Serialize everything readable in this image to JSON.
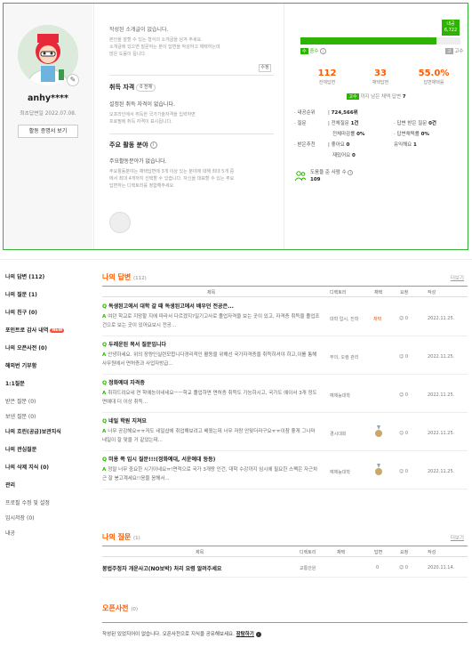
{
  "profile": {
    "username": "anhy****",
    "joined": "최초답변일 2022.07.08.",
    "cert_button": "활동 증명서 보기",
    "intro": {
      "title": "작성된 소개글이 없습니다.",
      "body": "본인을 잘할 수 있는 형식의 소개글을 남겨 주세요.\n소개글에 있으면 질문하는 분이 답변을 작성하고 체택하는데\n많은 도움이 됩니다.",
      "edit_label": "수정"
    },
    "license": {
      "title": "취득 자격",
      "pill": "0 전체",
      "main": "설정된 취득 자격이 없습니다.",
      "desc": "오프라인에서 취득한 국가기술자격을 입력하면\n프로필에 취득 자격이 표시됩니다."
    },
    "activity": {
      "title": "주요 활동 분야",
      "main": "주요활동분야가 없습니다.",
      "desc": "주요활동분야는 채택답변에 3개 이상 있는 분야에 대해 최대 5개 중\n에서 최대 4개까지 선택할 수 있습니다. 자신을 대표할 수 있는 주요\n답변하는 디렉토리를 정함해주세요."
    },
    "level": {
      "badge_top": "내공",
      "badge_value": "6,722",
      "progress_fraction": 0.85,
      "current_rank": "중수",
      "current_rank_icon": "수",
      "next_rank": "고수",
      "next_rank_icon": "고"
    },
    "stats": [
      {
        "value": "112",
        "label": "전체답변"
      },
      {
        "value": "33",
        "label": "채택답변"
      },
      {
        "value": "55.0%",
        "label": "답변채택률"
      }
    ],
    "next_level": {
      "badge": "고수",
      "text_prefix": "까지 남은 채택 답변",
      "count": "7"
    },
    "rank": {
      "label": "내공순위",
      "value": "724,566위"
    },
    "questions": {
      "label": "질문",
      "total_label": "전체질문",
      "total": "1건",
      "choice_rate_label": "전체마감률",
      "choice_rate": "0%",
      "answered_label": "답변 받은 질문",
      "answered": "0건",
      "answer_rate_label": "답변채택률",
      "answer_rate": "0%"
    },
    "recommend": {
      "label": "받은추천",
      "likes_label": "좋아요",
      "likes": "0",
      "expert_label": "유익해요",
      "expert": "1",
      "fun_label": "재밌어요",
      "fun": "0"
    },
    "donate": {
      "label": "도움을 준 사람 수",
      "count": "109"
    }
  },
  "sidebar": {
    "items": [
      {
        "label": "나의 답변 (112)",
        "head": true
      },
      {
        "label": "나의 질문 (1)",
        "head": true
      },
      {
        "label": "나의 친구 (0)",
        "head": true
      },
      {
        "label": "포인트로 감사 내역",
        "head": true,
        "badge": "NEW"
      },
      {
        "label": "나의 오픈사전 (0)",
        "head": true
      },
      {
        "label": "해외번 기부함",
        "head": true
      },
      {
        "label": "1:1질문",
        "head": true
      },
      {
        "label": "받은 질문 (0)",
        "head": false
      },
      {
        "label": "보낸 질문 (0)",
        "head": false
      },
      {
        "label": "나의 흐린(공급)보관지식",
        "head": true
      },
      {
        "label": "나의 관심질문",
        "head": true
      },
      {
        "label": "나의 삭제 지식 (0)",
        "head": true
      },
      {
        "label": "관리",
        "head": true
      },
      {
        "label": "프로필 수정 및 설정",
        "head": false
      },
      {
        "label": "임시저장 (0)",
        "head": false
      },
      {
        "label": "내공",
        "head": false
      }
    ]
  },
  "answers": {
    "title": "나의 답변",
    "count": "(112)",
    "more": "더보기",
    "headers": {
      "title": "제목",
      "directory": "디렉토리",
      "choice": "채택",
      "good": "요청",
      "date": "작성"
    },
    "rows": [
      {
        "q": "독생된고에서 대학 갈 때 독생된고에서 배우던 전공은...",
        "a": "여던 학교로 지망할 지에 따라서 다르겠지?일기고사로 졸업자격을 보는 곳이 있고, 자격증 취득을 졸업조건으로 보는 곳이 있어요보시 전공...",
        "dir": "대학 입시, 진학",
        "choice": "채택",
        "good": "0",
        "date": "2022.11.25.",
        "medal": false
      },
      {
        "q": "두레운된 목서 질문입니다",
        "a": "안녕하세요. 위의 장량인실련모합니다경리적인 활동을 위해선 국가자격증을 취득하셔야 하고,이를 통해 사무원에서 면허증과 사업자방급...",
        "dir": "무의, 오컴 관리",
        "choice": "",
        "good": "0",
        "date": "2022.11.25.",
        "medal": false
      },
      {
        "q": "정화예대 자격증",
        "a": "취하드려요네 연 학예능이네네요ㅡㅡ학교 졸업하면 면허증 취득도 가능하시고, 국가도 예이서 3개 정도면예대 더 이상 취득...",
        "dir": "예체능대학",
        "choice": "",
        "good": "0",
        "date": "2022.11.25.",
        "medal": false
      },
      {
        "q": "네일 학원 지쳐요",
        "a": "너무 공감해요ㅠㅠ저도 네일샵에 취업해보려고 배웠는데 너무 저랑 안맞더라구요ㅠㅠ이참 좋게 그나마 네일이 잘 맞을 거 같았는데...",
        "dir": "경시대회",
        "choice": "",
        "good": "0",
        "date": "2022.11.25.",
        "medal": true
      },
      {
        "q": "미용 쪽 입시 질문!!!(정화예대, 서운예대 등등)",
        "a": "정말 너무 중요한 시기이네요ㅠ!면적으로 국가 3개랑 인건, 대학 수강까지 임시에 필요한 스펙은 자근차근 잘 봉고계세요!!응을 응해서...",
        "dir": "예체능대학",
        "choice": "",
        "good": "0",
        "date": "2022.11.25.",
        "medal": true
      }
    ]
  },
  "my_questions": {
    "title": "나의 질문",
    "count": "(1)",
    "more": "더보기",
    "headers": {
      "title": "제목",
      "directory": "디렉토리",
      "choice": "채택",
      "answers": "답변",
      "good": "요청",
      "date": "작성"
    },
    "rows": [
      {
        "title": "봉법주정자 개운사고(NO보박) 처리 요령 알려주세요",
        "dir": "교통안원",
        "answers": "0",
        "good": "0",
        "date": "2020.11.14."
      }
    ]
  },
  "open_dict": {
    "title": "오픈사전",
    "count": "(0)",
    "text": "작성된 있었지어이 없습니다. 오픈사전으로 지식을 공유해보세요.",
    "link": "장탐하기"
  }
}
